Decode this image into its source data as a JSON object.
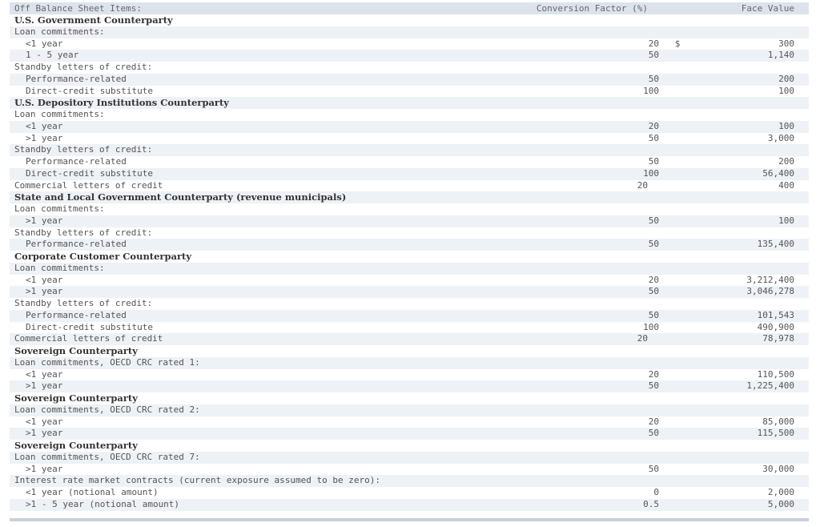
{
  "header": {
    "label": "Off Balance Sheet Items:",
    "conversion": "Conversion Factor (%)",
    "face": "Face Value"
  },
  "rows": [
    {
      "label": "U.S. Government Counterparty",
      "indent": 0,
      "bold": true,
      "conv": "",
      "dollar": "",
      "face": ""
    },
    {
      "label": "Loan commitments:",
      "indent": 0,
      "bold": false,
      "conv": "",
      "dollar": "",
      "face": ""
    },
    {
      "label": "<1 year",
      "indent": 1,
      "bold": false,
      "conv": "20",
      "dollar": "$",
      "face": "300"
    },
    {
      "label": "1 - 5 year",
      "indent": 1,
      "bold": false,
      "conv": "50",
      "dollar": "",
      "face": "1,140"
    },
    {
      "label": "Standby letters of credit:",
      "indent": 0,
      "bold": false,
      "conv": "",
      "dollar": "",
      "face": ""
    },
    {
      "label": "Performance-related",
      "indent": 1,
      "bold": false,
      "conv": "50",
      "dollar": "",
      "face": "200"
    },
    {
      "label": "Direct-credit substitute",
      "indent": 1,
      "bold": false,
      "conv": "100",
      "dollar": "",
      "face": "100"
    },
    {
      "label": "U.S. Depository Institutions Counterparty",
      "indent": 0,
      "bold": true,
      "conv": "",
      "dollar": "",
      "face": ""
    },
    {
      "label": "Loan commitments:",
      "indent": 0,
      "bold": false,
      "conv": "",
      "dollar": "",
      "face": ""
    },
    {
      "label": "<1 year",
      "indent": 1,
      "bold": false,
      "conv": "20",
      "dollar": "",
      "face": "100"
    },
    {
      "label": ">1 year",
      "indent": 1,
      "bold": false,
      "conv": "50",
      "dollar": "",
      "face": "3,000"
    },
    {
      "label": "Standby letters of credit:",
      "indent": 0,
      "bold": false,
      "conv": "",
      "dollar": "",
      "face": ""
    },
    {
      "label": "Performance-related",
      "indent": 1,
      "bold": false,
      "conv": "50",
      "dollar": "",
      "face": "200"
    },
    {
      "label": "Direct-credit substitute",
      "indent": 1,
      "bold": false,
      "conv": "100",
      "dollar": "",
      "face": "56,400"
    },
    {
      "label": "Commercial letters of credit",
      "indent": 0,
      "bold": false,
      "conv": "20",
      "dollar": "",
      "face": "400"
    },
    {
      "label": "State and Local Government Counterparty (revenue municipals)",
      "indent": 0,
      "bold": true,
      "conv": "",
      "dollar": "",
      "face": ""
    },
    {
      "label": "Loan commitments:",
      "indent": 0,
      "bold": false,
      "conv": "",
      "dollar": "",
      "face": ""
    },
    {
      "label": ">1 year",
      "indent": 1,
      "bold": false,
      "conv": "50",
      "dollar": "",
      "face": "100"
    },
    {
      "label": "Standby letters of credit:",
      "indent": 0,
      "bold": false,
      "conv": "",
      "dollar": "",
      "face": ""
    },
    {
      "label": "Performance-related",
      "indent": 1,
      "bold": false,
      "conv": "50",
      "dollar": "",
      "face": "135,400"
    },
    {
      "label": "Corporate Customer Counterparty",
      "indent": 0,
      "bold": true,
      "conv": "",
      "dollar": "",
      "face": ""
    },
    {
      "label": "Loan commitments:",
      "indent": 0,
      "bold": false,
      "conv": "",
      "dollar": "",
      "face": ""
    },
    {
      "label": "<1 year",
      "indent": 1,
      "bold": false,
      "conv": "20",
      "dollar": "",
      "face": "3,212,400"
    },
    {
      "label": ">1 year",
      "indent": 1,
      "bold": false,
      "conv": "50",
      "dollar": "",
      "face": "3,046,278"
    },
    {
      "label": "Standby letters of credit:",
      "indent": 0,
      "bold": false,
      "conv": "",
      "dollar": "",
      "face": ""
    },
    {
      "label": "Performance-related",
      "indent": 1,
      "bold": false,
      "conv": "50",
      "dollar": "",
      "face": "101,543"
    },
    {
      "label": "Direct-credit substitute",
      "indent": 1,
      "bold": false,
      "conv": "100",
      "dollar": "",
      "face": "490,900"
    },
    {
      "label": "Commercial letters of credit",
      "indent": 0,
      "bold": false,
      "conv": "20",
      "dollar": "",
      "face": "78,978"
    },
    {
      "label": "Sovereign Counterparty",
      "indent": 0,
      "bold": true,
      "conv": "",
      "dollar": "",
      "face": ""
    },
    {
      "label": "Loan commitments, OECD CRC rated 1:",
      "indent": 0,
      "bold": false,
      "conv": "",
      "dollar": "",
      "face": ""
    },
    {
      "label": "<1 year",
      "indent": 1,
      "bold": false,
      "conv": "20",
      "dollar": "",
      "face": "110,500"
    },
    {
      "label": ">1 year",
      "indent": 1,
      "bold": false,
      "conv": "50",
      "dollar": "",
      "face": "1,225,400"
    },
    {
      "label": "Sovereign Counterparty",
      "indent": 0,
      "bold": true,
      "conv": "",
      "dollar": "",
      "face": ""
    },
    {
      "label": "Loan commitments, OECD CRC rated 2:",
      "indent": 0,
      "bold": false,
      "conv": "",
      "dollar": "",
      "face": ""
    },
    {
      "label": "<1 year",
      "indent": 1,
      "bold": false,
      "conv": "20",
      "dollar": "",
      "face": "85,000"
    },
    {
      "label": ">1 year",
      "indent": 1,
      "bold": false,
      "conv": "50",
      "dollar": "",
      "face": "115,500"
    },
    {
      "label": "Sovereign Counterparty",
      "indent": 0,
      "bold": true,
      "conv": "",
      "dollar": "",
      "face": ""
    },
    {
      "label": "Loan commitments, OECD CRC rated 7:",
      "indent": 0,
      "bold": false,
      "conv": "",
      "dollar": "",
      "face": ""
    },
    {
      "label": ">1 year",
      "indent": 1,
      "bold": false,
      "conv": "50",
      "dollar": "",
      "face": "30,000"
    },
    {
      "label": "Interest rate market contracts (current exposure assumed to be zero):",
      "indent": 0,
      "bold": false,
      "conv": "",
      "dollar": "",
      "face": ""
    },
    {
      "label": "<1 year (notional amount)",
      "indent": 1,
      "bold": false,
      "conv": "0",
      "dollar": "",
      "face": "2,000"
    },
    {
      "label": ">1 - 5 year (notional amount)",
      "indent": 1,
      "bold": false,
      "conv": "0.5",
      "dollar": "",
      "face": "5,000"
    }
  ]
}
